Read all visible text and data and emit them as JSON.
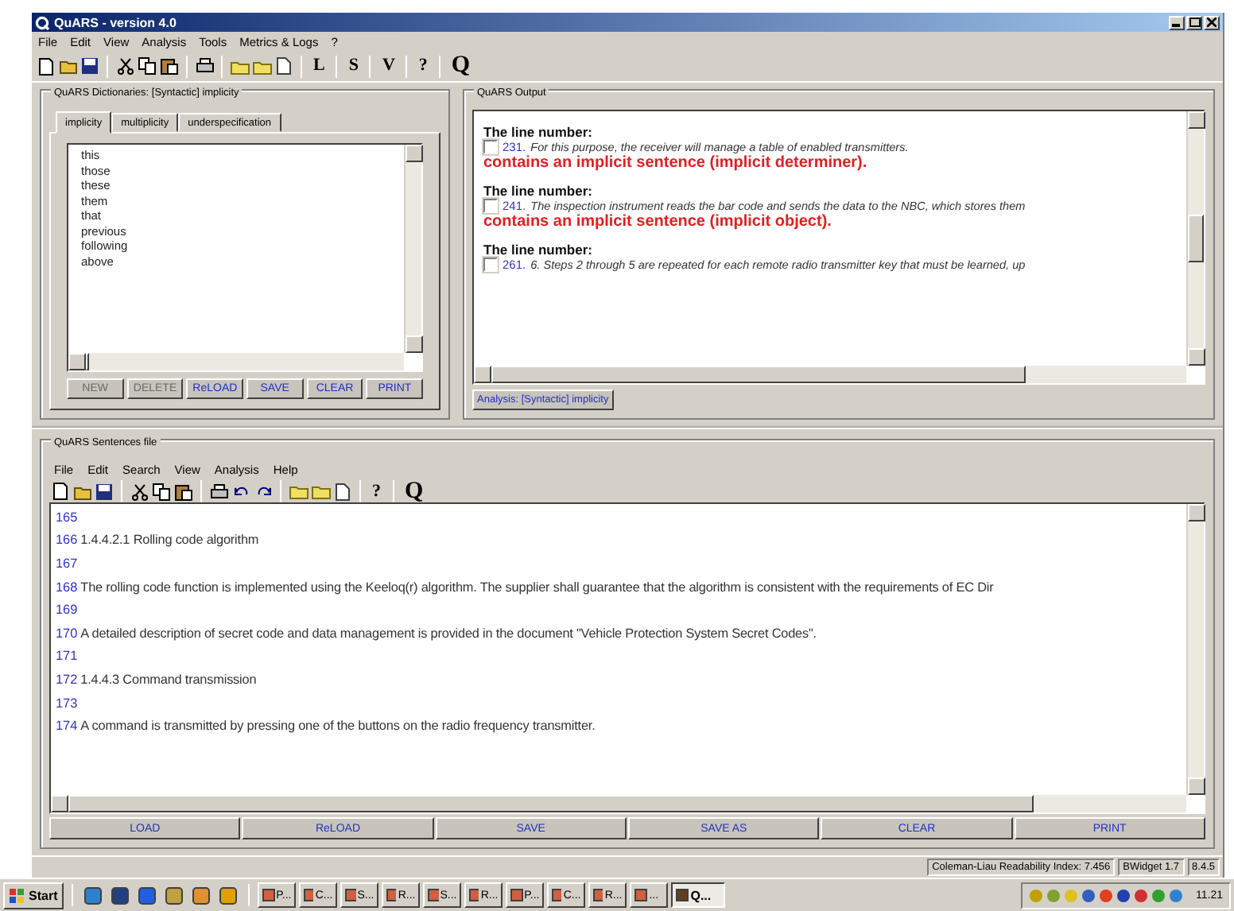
{
  "window": {
    "title": "QuARS - version 4.0"
  },
  "menu": [
    "File",
    "Edit",
    "View",
    "Analysis",
    "Tools",
    "Metrics & Logs",
    "?"
  ],
  "toolbar_letters": [
    "L",
    "S",
    "V",
    "?",
    "Q"
  ],
  "dictionaries": {
    "title": "QuARS Dictionaries: [Syntactic] implicity",
    "tabs": [
      {
        "label": "implicity",
        "selected": true
      },
      {
        "label": "multiplicity",
        "selected": false
      },
      {
        "label": "underspecification",
        "selected": false
      }
    ],
    "words": [
      "this",
      "those",
      "these",
      "them",
      "that",
      "previous",
      "following",
      "above"
    ],
    "buttons": [
      {
        "label": "NEW",
        "disabled": true
      },
      {
        "label": "DELETE",
        "disabled": true
      },
      {
        "label": "ReLOAD",
        "disabled": false
      },
      {
        "label": "SAVE",
        "disabled": false
      },
      {
        "label": "CLEAR",
        "disabled": false
      },
      {
        "label": "PRINT",
        "disabled": false
      }
    ]
  },
  "output": {
    "title": "QuARS Output",
    "entries": [
      {
        "heading": "The line number:",
        "checked": false,
        "number": "231.",
        "sentence": "For this purpose, the receiver will manage a table of enabled transmitters.",
        "warning": "contains an implicit sentence (implicit determiner)."
      },
      {
        "heading": "The line number:",
        "checked": false,
        "number": "241.",
        "sentence": "The inspection instrument reads the bar code and sends the data to the NBC, which stores them",
        "warning": "contains an implicit sentence (implicit object)."
      },
      {
        "heading": "The line number:",
        "checked": false,
        "number": "261.",
        "sentence": "6. Steps 2 through 5 are repeated for each remote radio transmitter key that must be learned, up"
      }
    ],
    "analysis_button": "Analysis: [Syntactic] implicity"
  },
  "sentences": {
    "title": "QuARS Sentences file",
    "menu": [
      "File",
      "Edit",
      "Search",
      "View",
      "Analysis",
      "Help"
    ],
    "toolbar_letters": [
      "?",
      "Q"
    ],
    "lines": [
      {
        "number": "165"
      },
      {
        "number": "166",
        "text": "1.4.4.2.1 Rolling code algorithm"
      },
      {
        "number": "167"
      },
      {
        "number": "168",
        "text": "The rolling code function is implemented using the Keeloq(r) algorithm. The supplier shall guarantee that the algorithm is consistent with the requirements of EC Dir"
      },
      {
        "number": "169"
      },
      {
        "number": "170",
        "text": "A detailed description of secret code and data management is provided in the document \"Vehicle Protection System Secret Codes\"."
      },
      {
        "number": "171"
      },
      {
        "number": "172",
        "text": "1.4.4.3 Command transmission"
      },
      {
        "number": "173"
      },
      {
        "number": "174",
        "text": "A command is transmitted by pressing one of the buttons on the radio frequency transmitter."
      }
    ],
    "buttons": [
      "LOAD",
      "ReLOAD",
      "SAVE",
      "SAVE AS",
      "CLEAR",
      "PRINT"
    ]
  },
  "status_bar": [
    "Coleman-Liau Readability Index: 7.456",
    "BWidget 1.7",
    "8.4.5"
  ],
  "taskbar": {
    "start": "Start",
    "tasks": [
      {
        "label": "P...",
        "selected": false
      },
      {
        "label": "C...",
        "selected": false
      },
      {
        "label": "S...",
        "selected": false
      },
      {
        "label": "R...",
        "selected": false
      },
      {
        "label": "S...",
        "selected": false
      },
      {
        "label": "R...",
        "selected": false
      },
      {
        "label": "P...",
        "selected": false
      },
      {
        "label": "C...",
        "selected": false
      },
      {
        "label": "R...",
        "selected": false
      },
      {
        "label": "...",
        "selected": false
      },
      {
        "label": "Q...",
        "selected": true
      }
    ],
    "clock": "11.21"
  }
}
